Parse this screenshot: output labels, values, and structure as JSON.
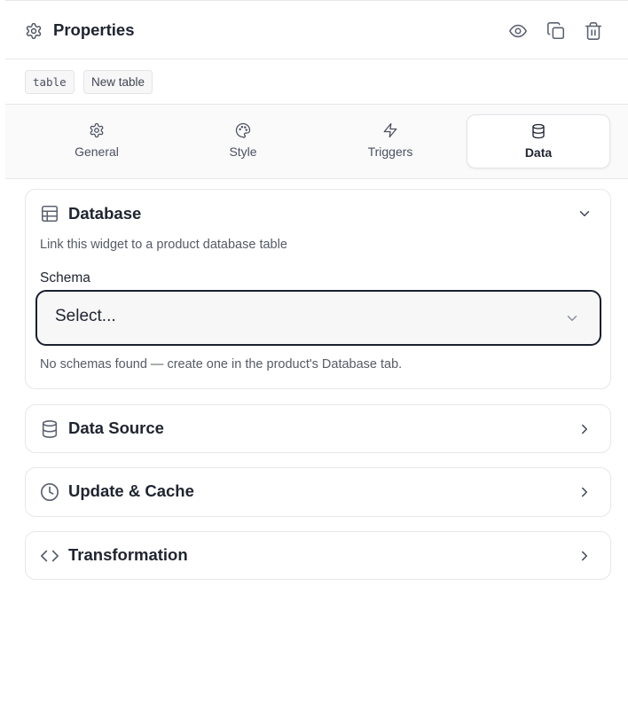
{
  "header": {
    "title": "Properties",
    "actions": [
      {
        "icon": "eye-icon",
        "label": "preview"
      },
      {
        "icon": "copy-icon",
        "label": "duplicate"
      },
      {
        "icon": "trash-icon",
        "label": "delete"
      }
    ]
  },
  "tags": {
    "type": "table",
    "name": "New table"
  },
  "tabs": [
    {
      "label": "General",
      "icon": "gear-icon",
      "active": false
    },
    {
      "label": "Style",
      "icon": "palette-icon",
      "active": false
    },
    {
      "label": "Triggers",
      "icon": "lightning-icon",
      "active": false
    },
    {
      "label": "Data",
      "icon": "database-icon",
      "active": true
    }
  ],
  "sections": {
    "database": {
      "title": "Database",
      "icon": "table-icon",
      "expanded": true,
      "description": "Link this widget to a product database table",
      "schema_label": "Schema",
      "schema_placeholder": "Select...",
      "hint": "No schemas found — create one in the product's Database tab."
    },
    "data_source": {
      "title": "Data Source",
      "icon": "database-icon",
      "expanded": false
    },
    "update_cache": {
      "title": "Update & Cache",
      "icon": "clock-icon",
      "expanded": false
    },
    "transformation": {
      "title": "Transformation",
      "icon": "code-icon",
      "expanded": false
    }
  },
  "colors": {
    "text": "#1f2430",
    "muted": "#555b66",
    "border": "#e5e7eb",
    "focus_border": "#1a1f2e",
    "icon": "#5b6170"
  }
}
